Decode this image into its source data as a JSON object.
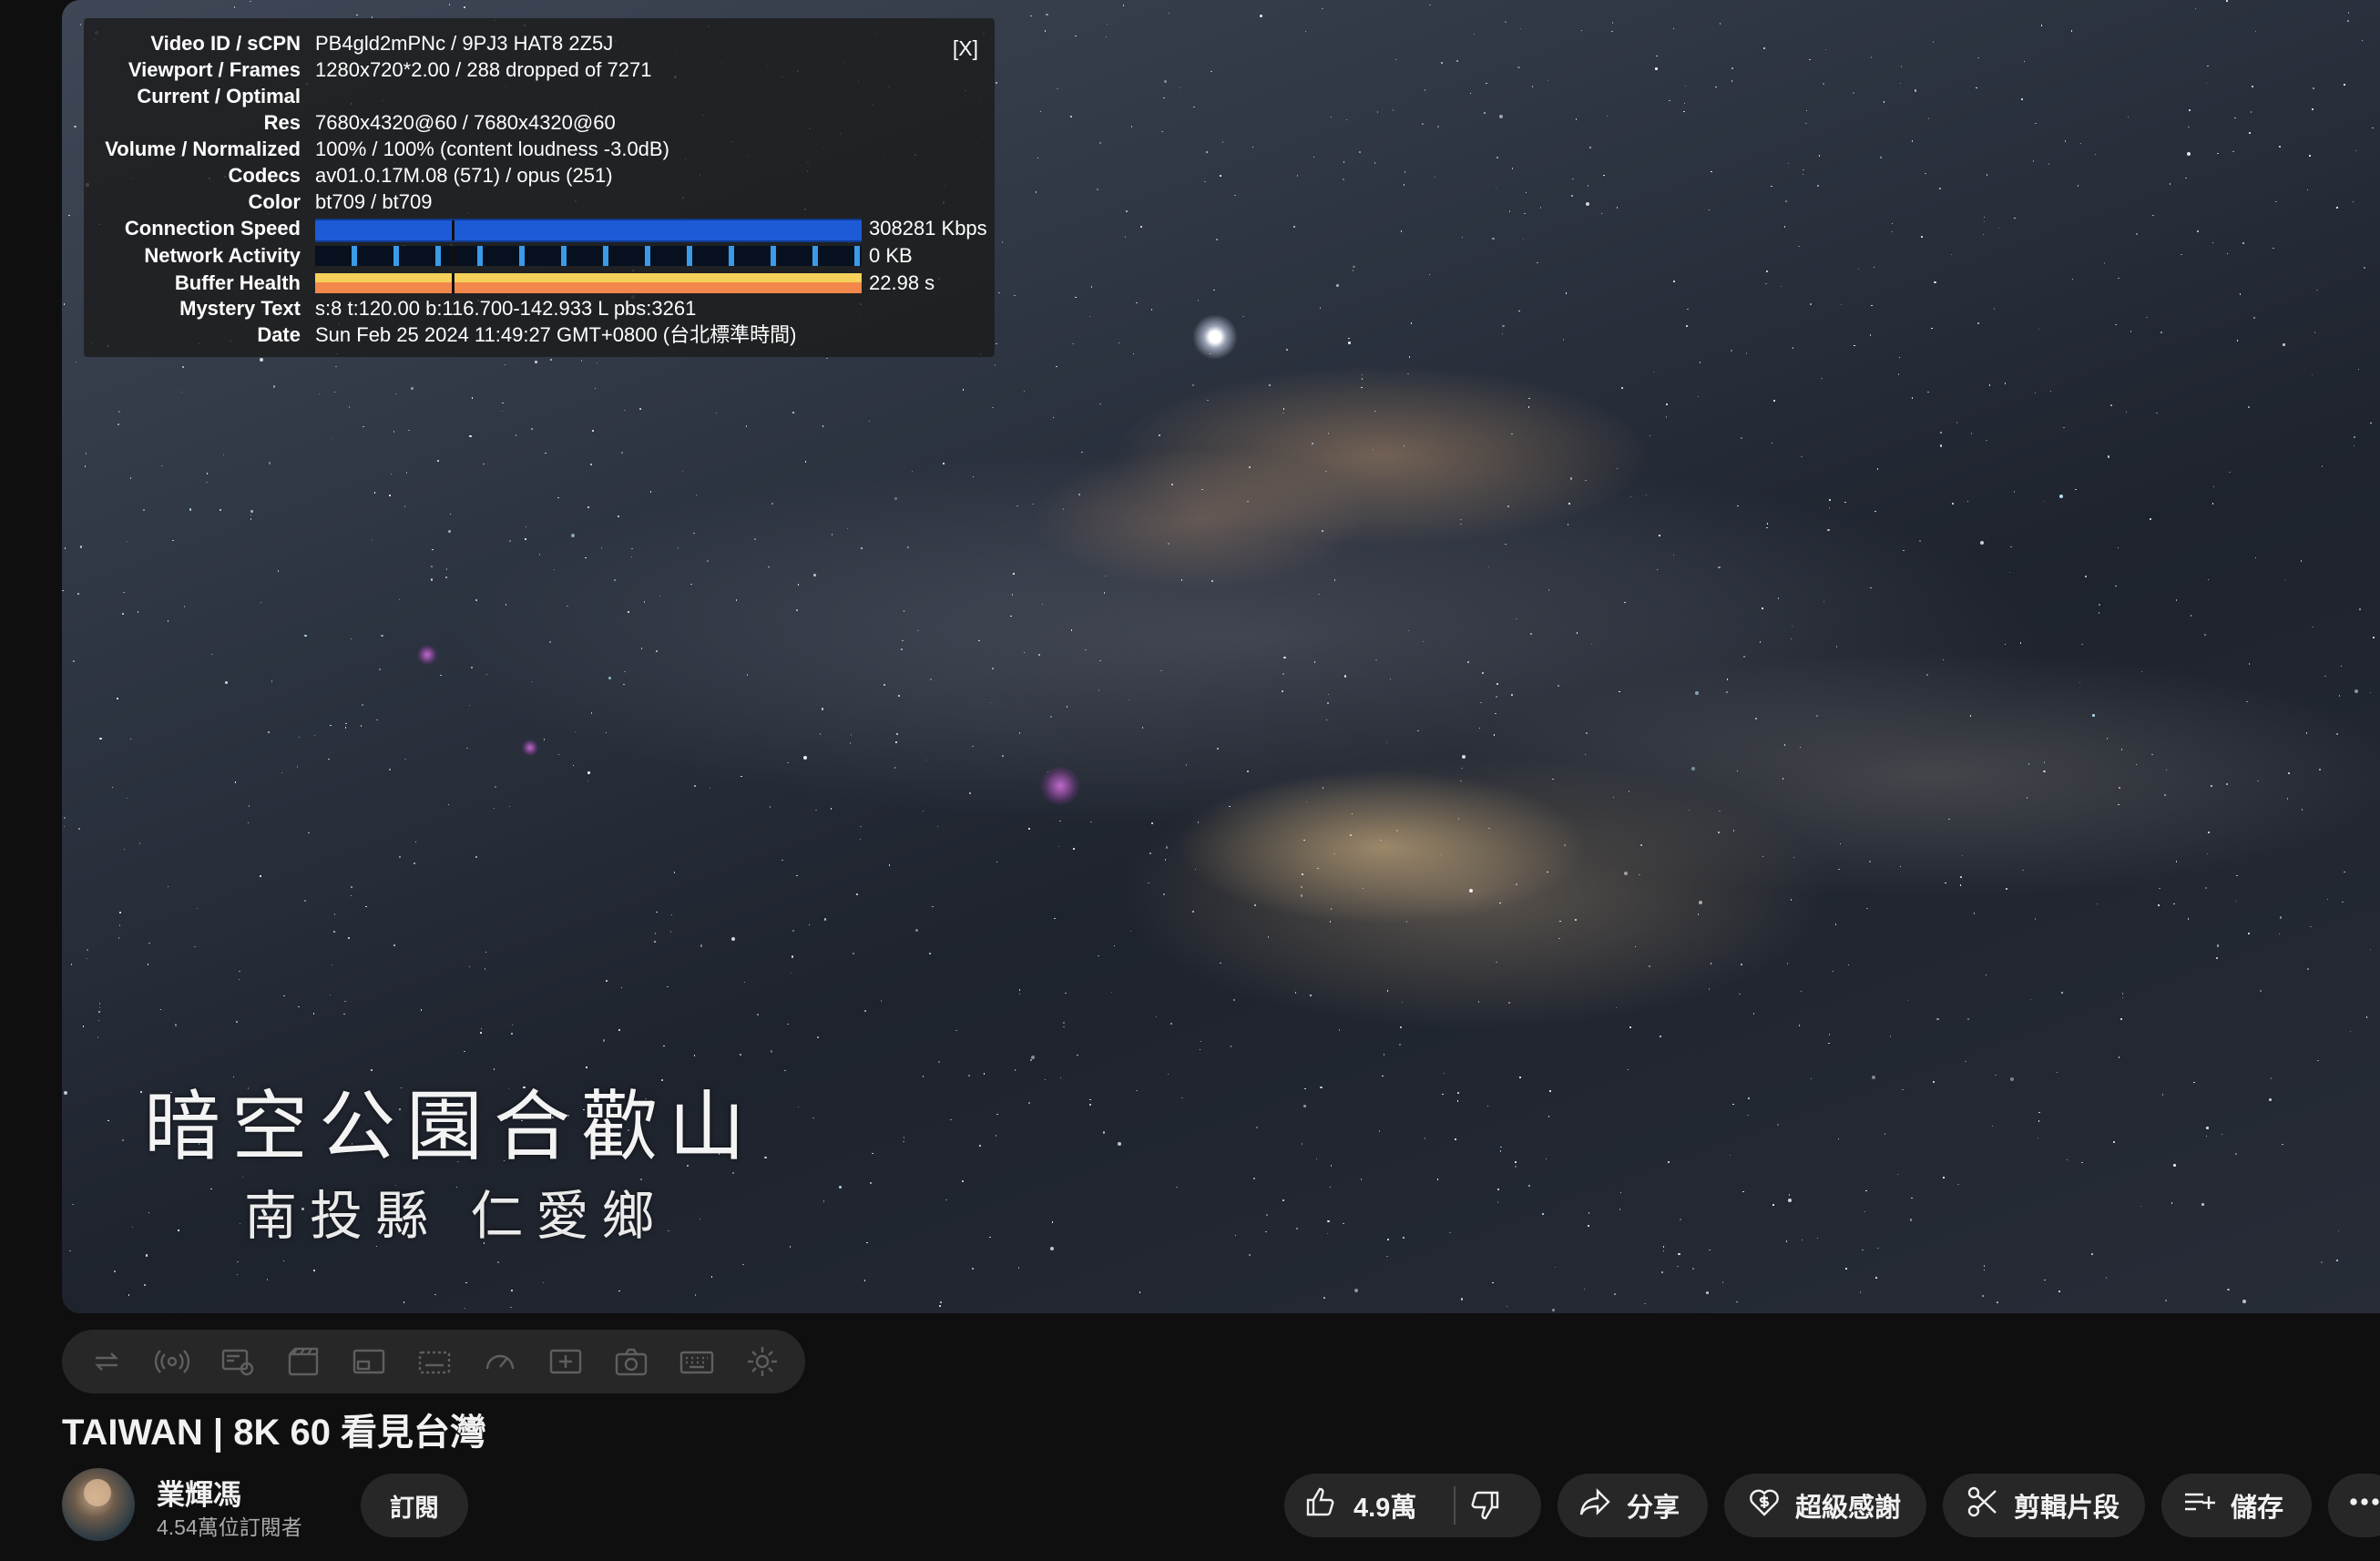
{
  "video": {
    "overlay_title": "暗空公園合歡山",
    "overlay_subtitle": "南投縣 仁愛鄉"
  },
  "stats_panel": {
    "close_label": "[X]",
    "rows": [
      {
        "label": "Video ID / sCPN",
        "value": "PB4gld2mPNc / 9PJ3 HAT8 2Z5J"
      },
      {
        "label": "Viewport / Frames",
        "value": "1280x720*2.00 / 288 dropped of 7271"
      },
      {
        "label": "Current / Optimal",
        "value": ""
      },
      {
        "label": "Res",
        "value": "7680x4320@60 / 7680x4320@60"
      },
      {
        "label": "Volume / Normalized",
        "value": "100% / 100% (content loudness -3.0dB)"
      },
      {
        "label": "Codecs",
        "value": "av01.0.17M.08 (571) / opus (251)"
      },
      {
        "label": "Color",
        "value": "bt709 / bt709"
      },
      {
        "label": "Connection Speed",
        "value": "308281 Kbps"
      },
      {
        "label": "Network Activity",
        "value": "0 KB"
      },
      {
        "label": "Buffer Health",
        "value": "22.98 s"
      },
      {
        "label": "Mystery Text",
        "value": "s:8 t:120.00 b:116.700-142.933 L pbs:3261"
      },
      {
        "label": "Date",
        "value": "Sun Feb 25 2024 11:49:27 GMT+0800 (台北標準時間)"
      }
    ],
    "colors": {
      "connection_speed_bar": "#1d5bd6",
      "network_activity_bar": "#3a9be8",
      "buffer_health_bar": "#f5d15a"
    }
  },
  "controls": {
    "icons": [
      "loop-icon",
      "broadcast-icon",
      "view-icon",
      "clapperboard-icon",
      "miniplayer-icon",
      "subtitle-screen-icon",
      "speed-icon",
      "add-icon",
      "camera-icon",
      "keyboard-icon",
      "settings-gear-icon"
    ]
  },
  "meta": {
    "title": "TAIWAN | 8K 60 看見台灣",
    "channel_name": "業輝馮",
    "subscribers": "4.54萬位訂閱者",
    "subscribe_label": "訂閱",
    "like_count": "4.9萬",
    "share_label": "分享",
    "thanks_label": "超級感謝",
    "clip_label": "剪輯片段",
    "save_label": "儲存"
  }
}
